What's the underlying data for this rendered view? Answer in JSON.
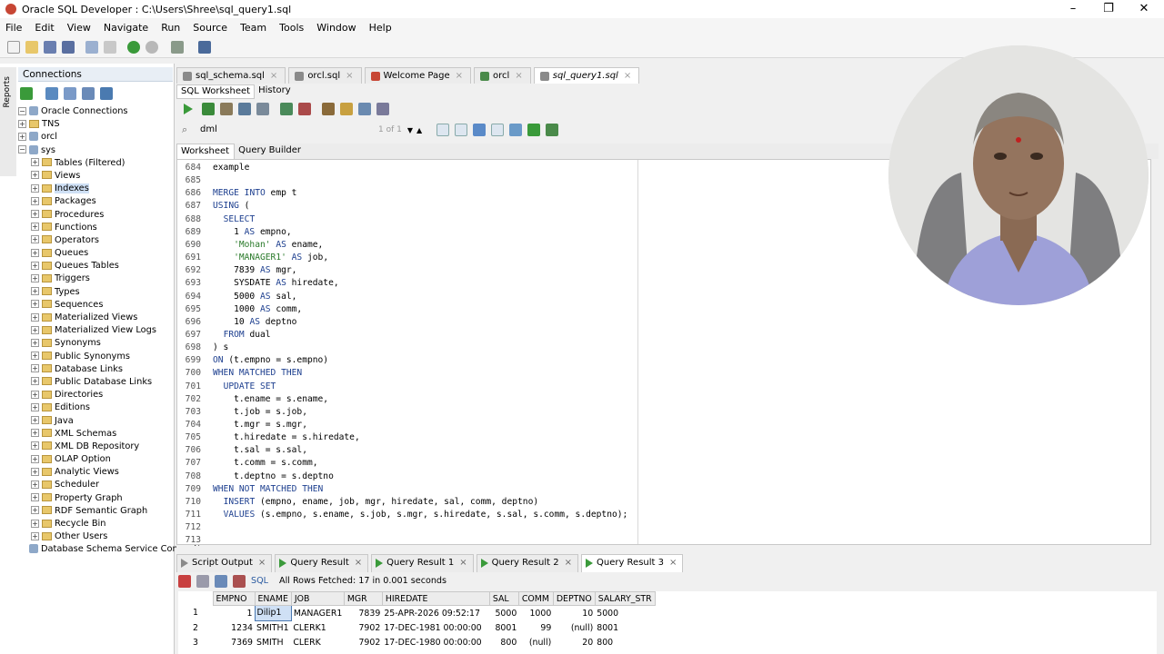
{
  "window": {
    "title": "Oracle SQL Developer : C:\\Users\\Shree\\sql_query1.sql",
    "controls": [
      "–",
      "❐",
      "✕"
    ]
  },
  "menu": [
    "File",
    "Edit",
    "View",
    "Navigate",
    "Run",
    "Source",
    "Team",
    "Tools",
    "Window",
    "Help"
  ],
  "sidebar": {
    "strip_label": "Reports",
    "header": "Connections",
    "tree": [
      {
        "label": "Oracle Connections",
        "level": 0,
        "type": "db"
      },
      {
        "label": "TNS",
        "level": 1,
        "type": "folder"
      },
      {
        "label": "orcl",
        "level": 1,
        "type": "db"
      },
      {
        "label": "sys",
        "level": 1,
        "type": "db"
      },
      {
        "label": "Tables (Filtered)",
        "level": 2,
        "type": "folder"
      },
      {
        "label": "Views",
        "level": 2,
        "type": "folder"
      },
      {
        "label": "Indexes",
        "level": 2,
        "type": "folder",
        "selected": true
      },
      {
        "label": "Packages",
        "level": 2,
        "type": "folder"
      },
      {
        "label": "Procedures",
        "level": 2,
        "type": "folder"
      },
      {
        "label": "Functions",
        "level": 2,
        "type": "folder"
      },
      {
        "label": "Operators",
        "level": 2,
        "type": "folder"
      },
      {
        "label": "Queues",
        "level": 2,
        "type": "folder"
      },
      {
        "label": "Queues Tables",
        "level": 2,
        "type": "folder"
      },
      {
        "label": "Triggers",
        "level": 2,
        "type": "folder"
      },
      {
        "label": "Types",
        "level": 2,
        "type": "folder"
      },
      {
        "label": "Sequences",
        "level": 2,
        "type": "folder"
      },
      {
        "label": "Materialized Views",
        "level": 2,
        "type": "folder"
      },
      {
        "label": "Materialized View Logs",
        "level": 2,
        "type": "folder"
      },
      {
        "label": "Synonyms",
        "level": 2,
        "type": "folder"
      },
      {
        "label": "Public Synonyms",
        "level": 2,
        "type": "folder"
      },
      {
        "label": "Database Links",
        "level": 2,
        "type": "folder"
      },
      {
        "label": "Public Database Links",
        "level": 2,
        "type": "folder"
      },
      {
        "label": "Directories",
        "level": 2,
        "type": "folder"
      },
      {
        "label": "Editions",
        "level": 2,
        "type": "folder"
      },
      {
        "label": "Java",
        "level": 2,
        "type": "folder"
      },
      {
        "label": "XML Schemas",
        "level": 2,
        "type": "folder"
      },
      {
        "label": "XML DB Repository",
        "level": 2,
        "type": "folder"
      },
      {
        "label": "OLAP Option",
        "level": 2,
        "type": "folder"
      },
      {
        "label": "Analytic Views",
        "level": 2,
        "type": "folder"
      },
      {
        "label": "Scheduler",
        "level": 2,
        "type": "folder"
      },
      {
        "label": "Property Graph",
        "level": 2,
        "type": "folder"
      },
      {
        "label": "RDF Semantic Graph",
        "level": 2,
        "type": "folder"
      },
      {
        "label": "Recycle Bin",
        "level": 2,
        "type": "folder"
      },
      {
        "label": "Other Users",
        "level": 2,
        "type": "folder"
      },
      {
        "label": "Database Schema Service Connections",
        "level": 0,
        "type": "db"
      }
    ]
  },
  "doc_tabs": [
    {
      "label": "sql_schema.sql",
      "color": "#8a8a8a"
    },
    {
      "label": "orcl.sql",
      "color": "#8a8a8a"
    },
    {
      "label": "Welcome Page",
      "color": "#c74634"
    },
    {
      "label": "orcl",
      "color": "#4a8a4a"
    },
    {
      "label": "sql_query1.sql",
      "color": "#8a8a8a",
      "active": true
    }
  ],
  "sub_tabs": [
    "SQL Worksheet",
    "History"
  ],
  "search": {
    "value": "dml",
    "count": "1 of 1"
  },
  "ws_tabs": [
    "Worksheet",
    "Query Builder"
  ],
  "code_lines": [
    {
      "n": "684",
      "t": "example"
    },
    {
      "n": "685",
      "t": ""
    },
    {
      "n": "686",
      "t": "MERGE INTO emp t"
    },
    {
      "n": "687",
      "t": "USING ("
    },
    {
      "n": "688",
      "t": "  SELECT"
    },
    {
      "n": "689",
      "t": "    1 AS empno,"
    },
    {
      "n": "690",
      "t": "    'Mohan' AS ename,"
    },
    {
      "n": "691",
      "t": "    'MANAGER1' AS job,"
    },
    {
      "n": "692",
      "t": "    7839 AS mgr,"
    },
    {
      "n": "693",
      "t": "    SYSDATE AS hiredate,"
    },
    {
      "n": "694",
      "t": "    5000 AS sal,"
    },
    {
      "n": "695",
      "t": "    1000 AS comm,"
    },
    {
      "n": "696",
      "t": "    10 AS deptno"
    },
    {
      "n": "697",
      "t": "  FROM dual"
    },
    {
      "n": "698",
      "t": ") s"
    },
    {
      "n": "699",
      "t": "ON (t.empno = s.empno)"
    },
    {
      "n": "700",
      "t": "WHEN MATCHED THEN"
    },
    {
      "n": "701",
      "t": "  UPDATE SET"
    },
    {
      "n": "702",
      "t": "    t.ename = s.ename,"
    },
    {
      "n": "703",
      "t": "    t.job = s.job,"
    },
    {
      "n": "704",
      "t": "    t.mgr = s.mgr,"
    },
    {
      "n": "705",
      "t": "    t.hiredate = s.hiredate,"
    },
    {
      "n": "706",
      "t": "    t.sal = s.sal,"
    },
    {
      "n": "707",
      "t": "    t.comm = s.comm,"
    },
    {
      "n": "708",
      "t": "    t.deptno = s.deptno"
    },
    {
      "n": "709",
      "t": "WHEN NOT MATCHED THEN"
    },
    {
      "n": "710",
      "t": "  INSERT (empno, ename, job, mgr, hiredate, sal, comm, deptno)"
    },
    {
      "n": "711",
      "t": "  VALUES (s.empno, s.ename, s.job, s.mgr, s.hiredate, s.sal, s.comm, s.deptno);"
    },
    {
      "n": "712",
      "t": ""
    },
    {
      "n": "713",
      "t": ""
    }
  ],
  "result_tabs": [
    {
      "label": "Script Output"
    },
    {
      "label": "Query Result"
    },
    {
      "label": "Query Result 1"
    },
    {
      "label": "Query Result 2"
    },
    {
      "label": "Query Result 3",
      "active": true
    }
  ],
  "result_bar": {
    "sql_label": "SQL",
    "status": "All Rows Fetched: 17 in 0.001 seconds"
  },
  "grid": {
    "columns": [
      "EMPNO",
      "ENAME",
      "JOB",
      "MGR",
      "HIREDATE",
      "SAL",
      "COMM",
      "DEPTNO",
      "SALARY_STR"
    ],
    "rows": [
      {
        "n": "1",
        "cells": [
          "1",
          "Dilip1",
          "MANAGER1",
          "7839",
          "25-APR-2026 09:52:17",
          "5000",
          "1000",
          "10",
          "5000"
        ]
      },
      {
        "n": "2",
        "cells": [
          "1234",
          "SMITH1",
          "CLERK1",
          "7902",
          "17-DEC-1981 00:00:00",
          "8001",
          "99",
          "(null)",
          "8001"
        ]
      },
      {
        "n": "3",
        "cells": [
          "7369",
          "SMITH",
          "CLERK",
          "7902",
          "17-DEC-1980 00:00:00",
          "800",
          "(null)",
          "20",
          "800"
        ]
      }
    ]
  }
}
